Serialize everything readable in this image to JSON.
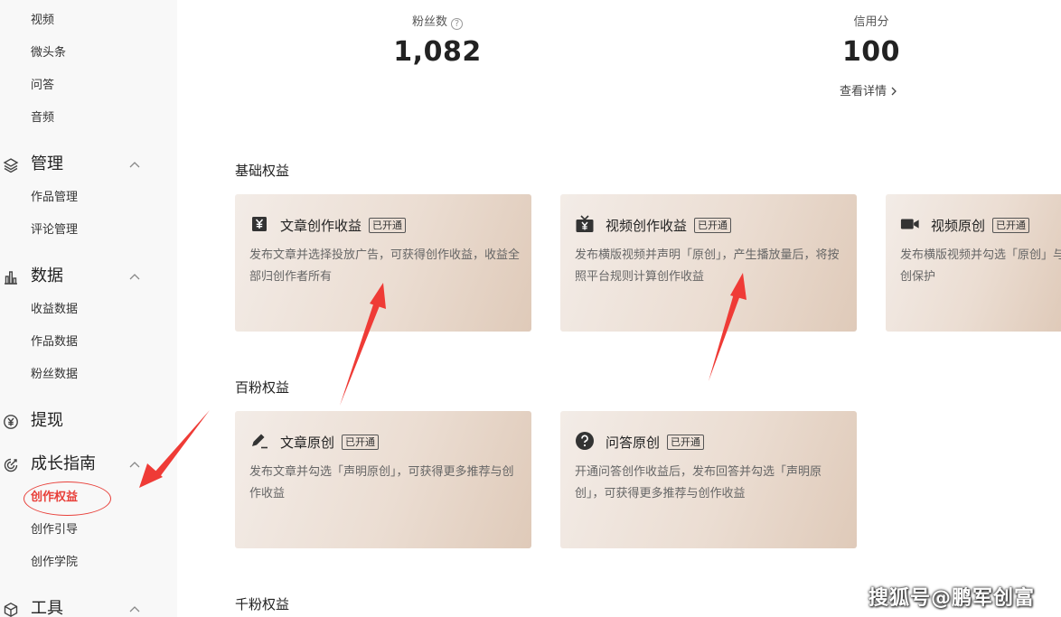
{
  "sidebar": {
    "items_top": [
      {
        "label": "视频"
      },
      {
        "label": "微头条"
      },
      {
        "label": "问答"
      },
      {
        "label": "音频"
      }
    ],
    "groups": {
      "manage": {
        "label": "管理",
        "icon": "layers-icon",
        "items": [
          {
            "label": "作品管理"
          },
          {
            "label": "评论管理"
          }
        ]
      },
      "data": {
        "label": "数据",
        "icon": "bar-chart-icon",
        "items": [
          {
            "label": "收益数据"
          },
          {
            "label": "作品数据"
          },
          {
            "label": "粉丝数据"
          }
        ]
      },
      "withdraw": {
        "label": "提现",
        "icon": "yen-circle-icon"
      },
      "growth": {
        "label": "成长指南",
        "icon": "growth-icon",
        "items": [
          {
            "label": "创作权益",
            "active": true
          },
          {
            "label": "创作引导"
          },
          {
            "label": "创作学院"
          }
        ]
      },
      "tools": {
        "label": "工具",
        "icon": "cube-icon"
      }
    },
    "accent_color": "#e8403a"
  },
  "stats": {
    "fans": {
      "label": "粉丝数",
      "value": "1,082"
    },
    "credit": {
      "label": "信用分",
      "value": "100",
      "link": "查看详情"
    }
  },
  "sections": {
    "basic": {
      "title": "基础权益",
      "cards": [
        {
          "icon": "yen-doc-icon",
          "title": "文章创作收益",
          "badge": "已开通",
          "desc": "发布文章并选择投放广告，可获得创作收益，收益全部归创作者所有"
        },
        {
          "icon": "tv-icon",
          "title": "视频创作收益",
          "badge": "已开通",
          "desc": "发布横版视频并声明「原创」，产生播放量后，将按照平台规则计算创作收益"
        },
        {
          "icon": "camera-icon",
          "title": "视频原创",
          "badge": "已开通",
          "desc": "发布横版视频并勾选「原创」与创作收益，并享受原创保护"
        }
      ]
    },
    "hundred": {
      "title": "百粉权益",
      "cards": [
        {
          "icon": "pen-icon",
          "title": "文章原创",
          "badge": "已开通",
          "desc": "发布文章并勾选「声明原创」，可获得更多推荐与创作收益"
        },
        {
          "icon": "question-icon",
          "title": "问答原创",
          "badge": "已开通",
          "desc": "开通问答创作收益后，发布回答并勾选「声明原创」，可获得更多推荐与创作收益"
        }
      ]
    },
    "thousand": {
      "title": "千粉权益"
    }
  },
  "watermark": "搜狐号@鹏军创富",
  "annotation_color": "#ef3b36"
}
